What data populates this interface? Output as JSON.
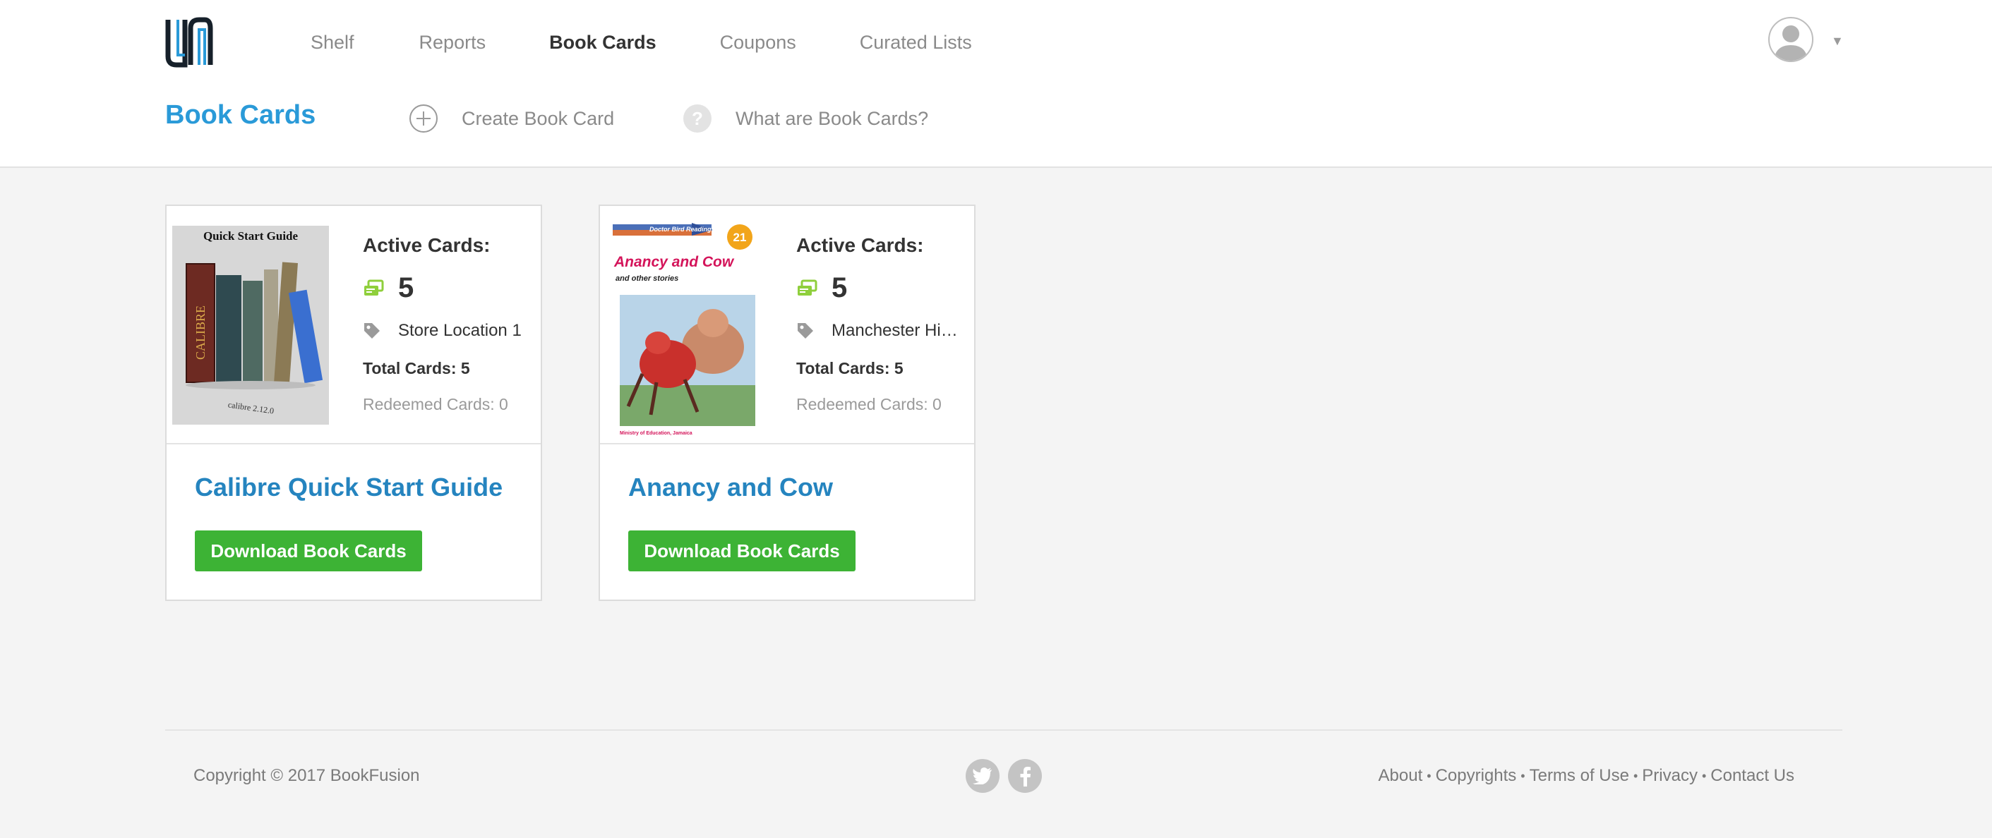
{
  "nav": {
    "items": [
      {
        "label": "Shelf",
        "active": false
      },
      {
        "label": "Reports",
        "active": false
      },
      {
        "label": "Book Cards",
        "active": true
      },
      {
        "label": "Coupons",
        "active": false
      },
      {
        "label": "Curated Lists",
        "active": false
      }
    ]
  },
  "page": {
    "title": "Book Cards",
    "create_label": "Create Book Card",
    "help_label": "What are Book Cards?",
    "help_glyph": "?"
  },
  "cards": [
    {
      "cover_title": "Quick Start Guide",
      "cover_spine": "CALIBRE",
      "cover_version": "calibre 2.12.0",
      "active_label": "Active Cards:",
      "active_count": "5",
      "location": "Store Location 1",
      "total": "Total Cards: 5",
      "redeemed": "Redeemed Cards: 0",
      "title": "Calibre Quick Start Guide",
      "button": "Download Book Cards"
    },
    {
      "cover_series": "Doctor Bird Reading Series",
      "cover_number": "21",
      "cover_title": "Anancy and Cow",
      "cover_subtitle": "and other stories",
      "cover_publisher": "Ministry of Education, Jamaica",
      "active_label": "Active Cards:",
      "active_count": "5",
      "location": "Manchester Hig...",
      "total": "Total Cards: 5",
      "redeemed": "Redeemed Cards: 0",
      "title": "Anancy and Cow",
      "button": "Download Book Cards"
    }
  ],
  "footer": {
    "copyright": "Copyright © 2017 BookFusion",
    "links": [
      "About",
      "Copyrights",
      "Terms of Use",
      "Privacy",
      "Contact Us"
    ],
    "social": [
      "twitter-icon",
      "facebook-icon"
    ]
  },
  "colors": {
    "accent": "#2a9ad8",
    "title_link": "#2584bf",
    "button_green": "#3db335",
    "icon_green": "#8fcf3c"
  }
}
